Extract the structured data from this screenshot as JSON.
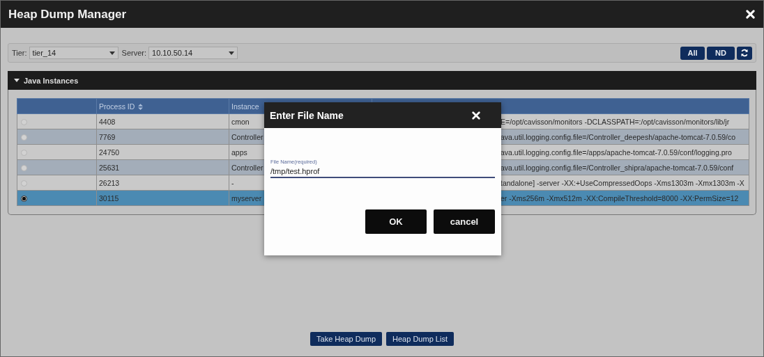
{
  "window": {
    "title": "Heap Dump Manager"
  },
  "toolbar": {
    "tier": {
      "label": "Tier:",
      "value": "tier_14"
    },
    "server": {
      "label": "Server:",
      "value": "10.10.50.14"
    },
    "buttons": [
      "All",
      "ND"
    ]
  },
  "section": {
    "title": "Java Instances",
    "expanded": true
  },
  "table": {
    "header_labels": [
      "Process ID",
      "Instance"
    ],
    "rows": [
      {
        "selected": false,
        "process_id": "4408",
        "instance": "cmon",
        "arguments": "E=/opt/cavisson/monitors -DCLASSPATH=:/opt/cavisson/monitors/lib/jr"
      },
      {
        "selected": false,
        "process_id": "7769",
        "instance": "Controller",
        "arguments": "ava.util.logging.config.file=/Controller_deepesh/apache-tomcat-7.0.59/co"
      },
      {
        "selected": false,
        "process_id": "24750",
        "instance": "apps",
        "arguments": "ava.util.logging.config.file=/apps/apache-tomcat-7.0.59/conf/logging.pro"
      },
      {
        "selected": false,
        "process_id": "25631",
        "instance": "Controller",
        "arguments": "ava.util.logging.config.file=/Controller_shipra/apache-tomcat-7.0.59/conf"
      },
      {
        "selected": false,
        "process_id": "26213",
        "instance": "-",
        "arguments": "tandalone] -server -XX:+UseCompressedOops -Xms1303m -Xmx1303m -X"
      },
      {
        "selected": true,
        "process_id": "30115",
        "instance": "myserver",
        "arguments": "er -Xms256m -Xmx512m -XX:CompileThreshold=8000 -XX:PermSize=12"
      }
    ]
  },
  "dialog": {
    "title": "Enter File Name",
    "field": {
      "label": "File Name(required)",
      "value": "/tmp/test.hprof"
    },
    "buttons": [
      "OK",
      "cancel"
    ]
  },
  "footer_buttons": [
    "Take Heap Dump",
    "Heap Dump List"
  ]
}
